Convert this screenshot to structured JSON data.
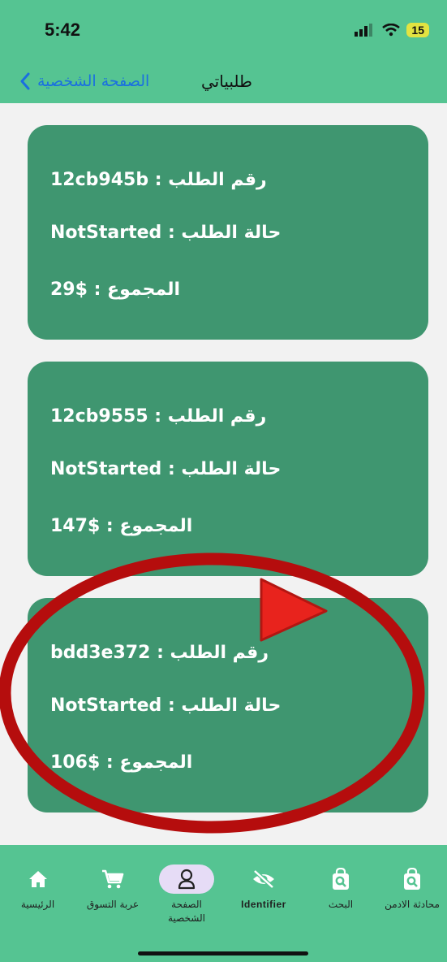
{
  "status_bar": {
    "time": "5:42",
    "battery": "15"
  },
  "nav": {
    "back_label": "الصفحة الشخصية",
    "title": "طلبياتي"
  },
  "orders": [
    {
      "id_line": "رقم الطلب : 12cb945b",
      "status_line": "حالة الطلب : NotStarted",
      "total_line": "المجموع : $29"
    },
    {
      "id_line": "رقم الطلب : 12cb9555",
      "status_line": "حالة الطلب : NotStarted",
      "total_line": "المجموع : $147"
    },
    {
      "id_line": "رقم الطلب : bdd3e372",
      "status_line": "حالة الطلب : NotStarted",
      "total_line": "المجموع : $106"
    }
  ],
  "tabs": [
    {
      "label": "الرئيسية",
      "icon": "home-icon"
    },
    {
      "label": "عربة التسوق",
      "icon": "cart-icon"
    },
    {
      "label": "الصفحة الشخصية",
      "icon": "person-icon",
      "active": true
    },
    {
      "label": "Identifier",
      "icon": "eye-off-icon"
    },
    {
      "label": "البحث",
      "icon": "search-bag-icon"
    },
    {
      "label": "محادثة الادمن",
      "icon": "search-bag-icon"
    }
  ],
  "colors": {
    "header": "#55c492",
    "card": "#3f9670",
    "active_tab": "#e6dcf6",
    "link": "#1a6fe0",
    "annotation": "#b50d0d"
  }
}
